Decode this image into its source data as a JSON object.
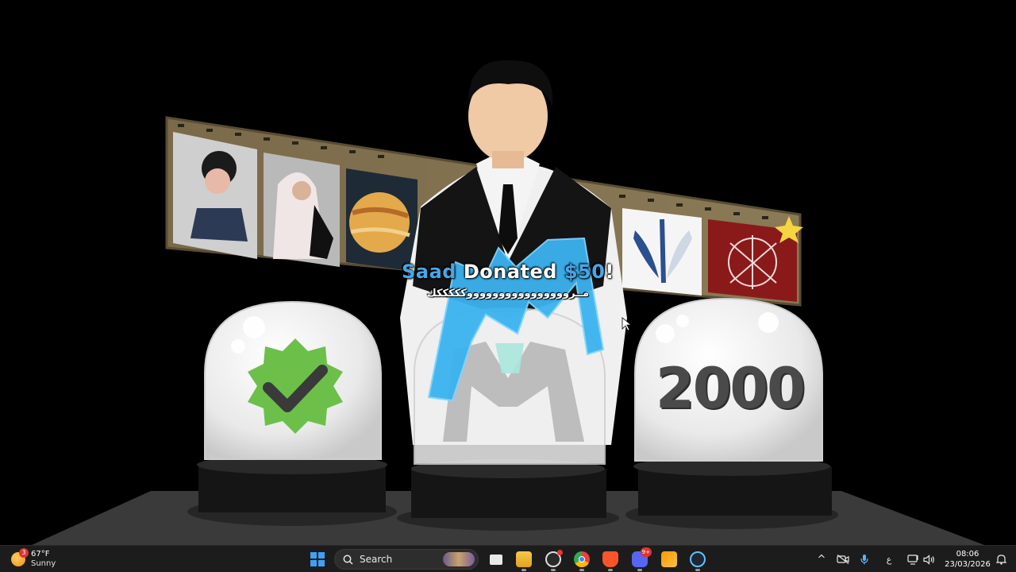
{
  "alert": {
    "name": "Saad",
    "donated_word": " Donated ",
    "amount": "$50",
    "suffix": "!",
    "message": "مــرووووووووووووووووكككككك"
  },
  "domes": {
    "left_icon": "verified-check-badge-icon",
    "center_icon": "m-logo-icon",
    "right_label": "2000"
  },
  "filmstrip": {
    "frames": [
      "boy-portrait",
      "man-in-shemagh-portrait",
      "planet-jupiter",
      "hidden-frame",
      "hidden-frame",
      "scout-regiment-emblem",
      "arabic-calligraphy-emblem"
    ]
  },
  "colors": {
    "accent_blue": "#4aa6e6",
    "badge_green": "#6cc04a",
    "background": "#000000",
    "taskbar": "#1c1c1c"
  },
  "taskbar": {
    "weather": {
      "badge": "3",
      "temp": "67°F",
      "condition": "Sunny"
    },
    "search_label": "Search",
    "apps": [
      {
        "name": "task-view-icon",
        "badge": ""
      },
      {
        "name": "file-explorer-icon",
        "badge": ""
      },
      {
        "name": "obs-icon",
        "badge": ""
      },
      {
        "name": "chrome-icon",
        "badge": ""
      },
      {
        "name": "brave-icon",
        "badge": ""
      },
      {
        "name": "discord-icon",
        "badge": "9+"
      },
      {
        "name": "sublime-icon",
        "badge": ""
      },
      {
        "name": "steam-icon",
        "badge": ""
      }
    ],
    "tray": {
      "chevron": "^",
      "lang": "ع"
    },
    "clock": {
      "time": "08:06",
      "date": "23/03/2026"
    }
  }
}
